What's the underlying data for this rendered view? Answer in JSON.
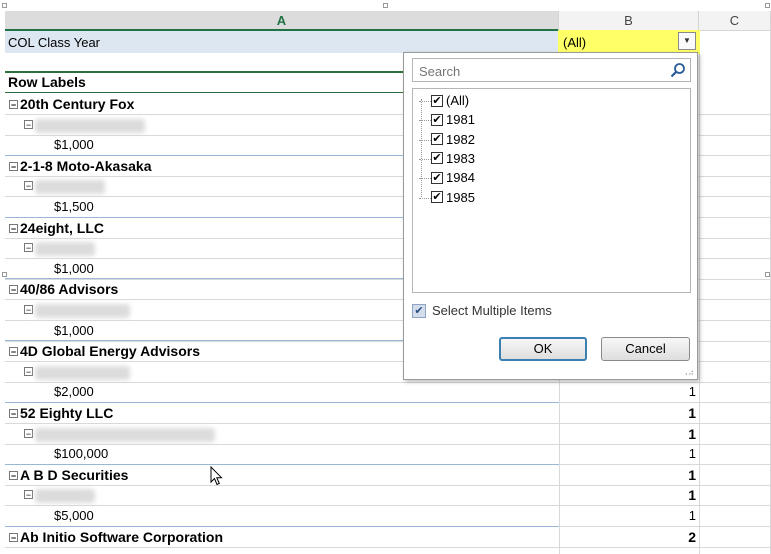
{
  "columns": {
    "a": "A",
    "b": "B",
    "c": "C"
  },
  "filter": {
    "label": "COL Class Year",
    "value": "(All)"
  },
  "pivot": {
    "row_labels_header": "Row Labels",
    "rows": [
      {
        "type": "group",
        "label": "20th Century Fox",
        "count": ""
      },
      {
        "type": "sub",
        "count": ""
      },
      {
        "type": "amount",
        "label": "$1,000",
        "count": ""
      },
      {
        "type": "group",
        "label": "2-1-8 Moto-Akasaka",
        "count": ""
      },
      {
        "type": "sub",
        "count": ""
      },
      {
        "type": "amount",
        "label": "$1,500",
        "count": ""
      },
      {
        "type": "group",
        "label": "24eight, LLC",
        "count": ""
      },
      {
        "type": "sub",
        "count": ""
      },
      {
        "type": "amount",
        "label": "$1,000",
        "count": ""
      },
      {
        "type": "group",
        "label": "40/86 Advisors",
        "count": ""
      },
      {
        "type": "sub",
        "count": ""
      },
      {
        "type": "amount",
        "label": "$1,000",
        "count": ""
      },
      {
        "type": "group",
        "label": "4D Global Energy Advisors",
        "count": ""
      },
      {
        "type": "sub",
        "count": ""
      },
      {
        "type": "amount",
        "label": "$2,000",
        "count": "1"
      },
      {
        "type": "group",
        "label": "52 Eighty LLC",
        "count": "1"
      },
      {
        "type": "sub",
        "count": "1"
      },
      {
        "type": "amount",
        "label": "$100,000",
        "count": "1"
      },
      {
        "type": "group",
        "label": "A B D Securities",
        "count": "1"
      },
      {
        "type": "sub",
        "count": "1"
      },
      {
        "type": "amount",
        "label": "$5,000",
        "count": "1"
      },
      {
        "type": "group",
        "label": "Ab Initio Software Corporation",
        "count": "2"
      }
    ]
  },
  "dropdown": {
    "search_placeholder": "Search",
    "items": [
      {
        "label": "(All)",
        "checked": true
      },
      {
        "label": "1981",
        "checked": true
      },
      {
        "label": "1982",
        "checked": true
      },
      {
        "label": "1983",
        "checked": true
      },
      {
        "label": "1984",
        "checked": true
      },
      {
        "label": "1985",
        "checked": true
      }
    ],
    "multi_label": "Select Multiple Items",
    "ok_label": "OK",
    "cancel_label": "Cancel"
  }
}
